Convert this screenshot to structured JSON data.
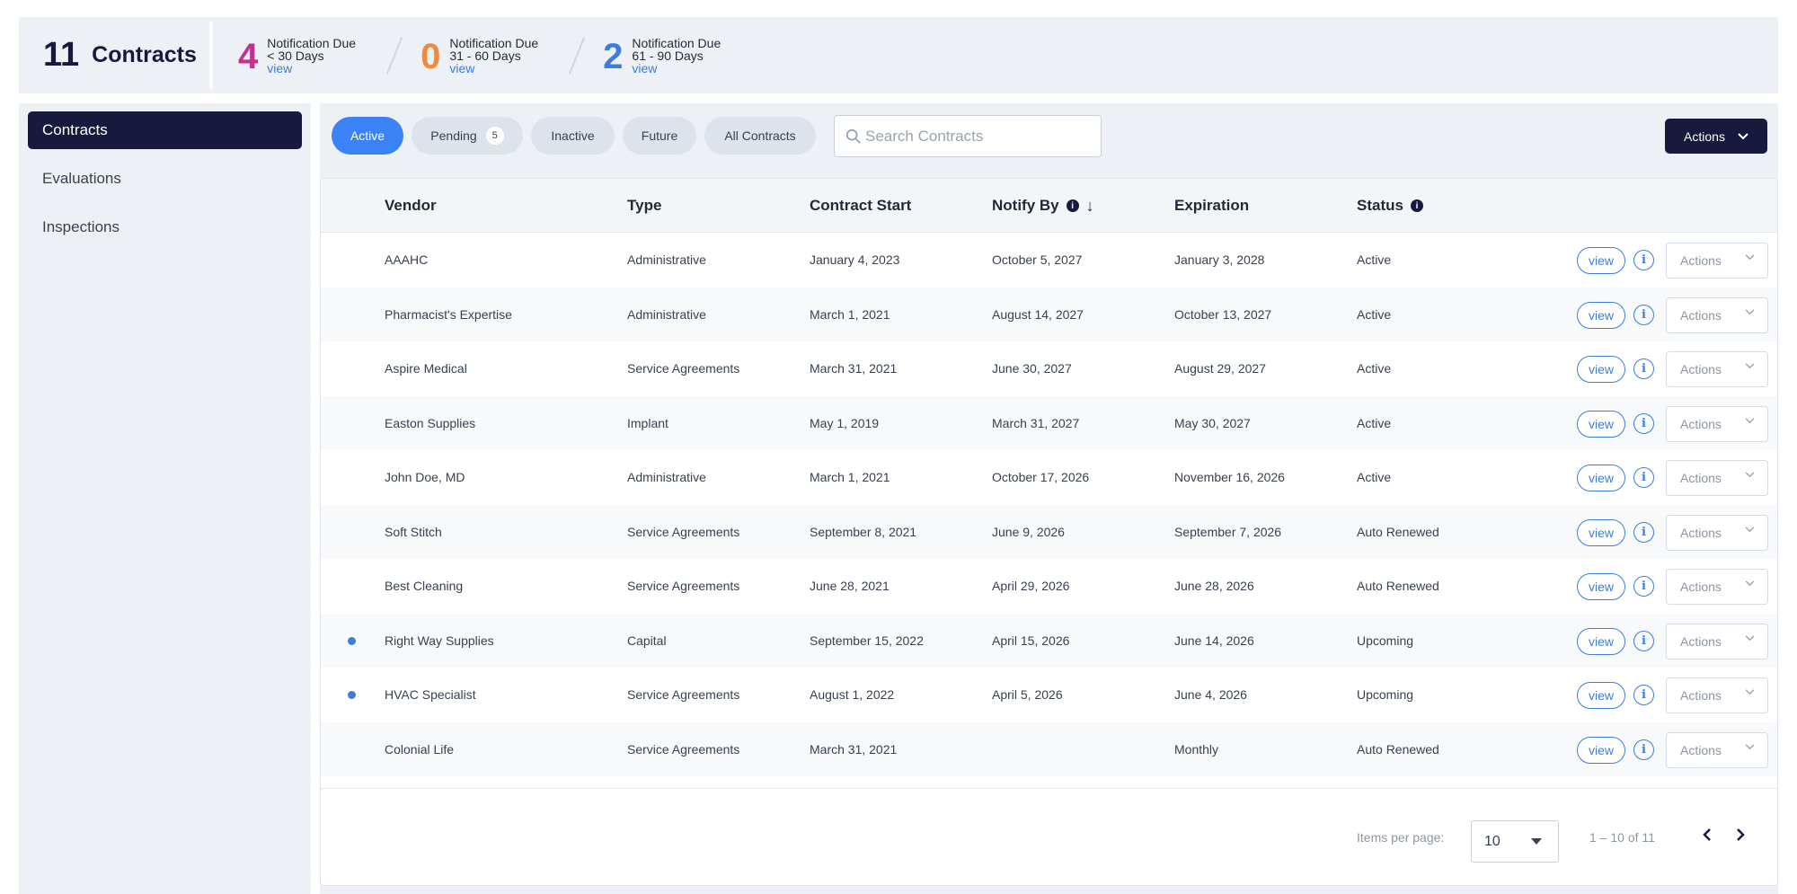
{
  "summary": {
    "total_count": "11",
    "total_label": "Contracts",
    "notifications": [
      {
        "count": "4",
        "color": "#c2338f",
        "title": "Notification Due",
        "range": "< 30 Days",
        "link": "view"
      },
      {
        "count": "0",
        "color": "#f08a3c",
        "title": "Notification Due",
        "range": "31 - 60 Days",
        "link": "view"
      },
      {
        "count": "2",
        "color": "#3b7ddd",
        "title": "Notification Due",
        "range": "61 - 90 Days",
        "link": "view"
      }
    ]
  },
  "sidebar": {
    "items": [
      {
        "label": "Contracts",
        "active": true
      },
      {
        "label": "Evaluations",
        "active": false
      },
      {
        "label": "Inspections",
        "active": false
      }
    ]
  },
  "toolbar": {
    "tabs": [
      {
        "label": "Active",
        "active": true
      },
      {
        "label": "Pending",
        "badge": "5"
      },
      {
        "label": "Inactive"
      },
      {
        "label": "Future"
      },
      {
        "label": "All Contracts"
      }
    ],
    "search_placeholder": "Search Contracts",
    "actions_label": "Actions"
  },
  "table": {
    "columns": [
      "Vendor",
      "Type",
      "Contract Start",
      "Notify By",
      "Expiration",
      "Status"
    ],
    "rows": [
      {
        "vendor": "AAAHC",
        "type": "Administrative",
        "start": "January 4, 2023",
        "notify": "October 5, 2027",
        "expiration": "January 3, 2028",
        "status": "Active",
        "dot": false
      },
      {
        "vendor": "Pharmacist's Expertise",
        "type": "Administrative",
        "start": "March 1, 2021",
        "notify": "August 14, 2027",
        "expiration": "October 13, 2027",
        "status": "Active",
        "dot": false
      },
      {
        "vendor": "Aspire Medical",
        "type": "Service Agreements",
        "start": "March 31, 2021",
        "notify": "June 30, 2027",
        "expiration": "August 29, 2027",
        "status": "Active",
        "dot": false
      },
      {
        "vendor": "Easton Supplies",
        "type": "Implant",
        "start": "May 1, 2019",
        "notify": "March 31, 2027",
        "expiration": "May 30, 2027",
        "status": "Active",
        "dot": false
      },
      {
        "vendor": "John Doe, MD",
        "type": "Administrative",
        "start": "March 1, 2021",
        "notify": "October 17, 2026",
        "expiration": "November 16, 2026",
        "status": "Active",
        "dot": false
      },
      {
        "vendor": "Soft Stitch",
        "type": "Service Agreements",
        "start": "September 8, 2021",
        "notify": "June 9, 2026",
        "expiration": "September 7, 2026",
        "status": "Auto Renewed",
        "dot": false
      },
      {
        "vendor": "Best Cleaning",
        "type": "Service Agreements",
        "start": "June 28, 2021",
        "notify": "April 29, 2026",
        "expiration": "June 28, 2026",
        "status": "Auto Renewed",
        "dot": false
      },
      {
        "vendor": "Right Way Supplies",
        "type": "Capital",
        "start": "September 15, 2022",
        "notify": "April 15, 2026",
        "expiration": "June 14, 2026",
        "status": "Upcoming",
        "dot": true
      },
      {
        "vendor": "HVAC Specialist",
        "type": "Service Agreements",
        "start": "August 1, 2022",
        "notify": "April 5, 2026",
        "expiration": "June 4, 2026",
        "status": "Upcoming",
        "dot": true
      },
      {
        "vendor": "Colonial Life",
        "type": "Service Agreements",
        "start": "March 31, 2021",
        "notify": "",
        "expiration": "Monthly",
        "status": "Auto Renewed",
        "dot": false
      }
    ],
    "row_view_label": "view",
    "row_actions_label": "Actions"
  },
  "pagination": {
    "items_per_page_label": "Items per page:",
    "items_per_page": "10",
    "range_text": "1 – 10 of 11"
  }
}
